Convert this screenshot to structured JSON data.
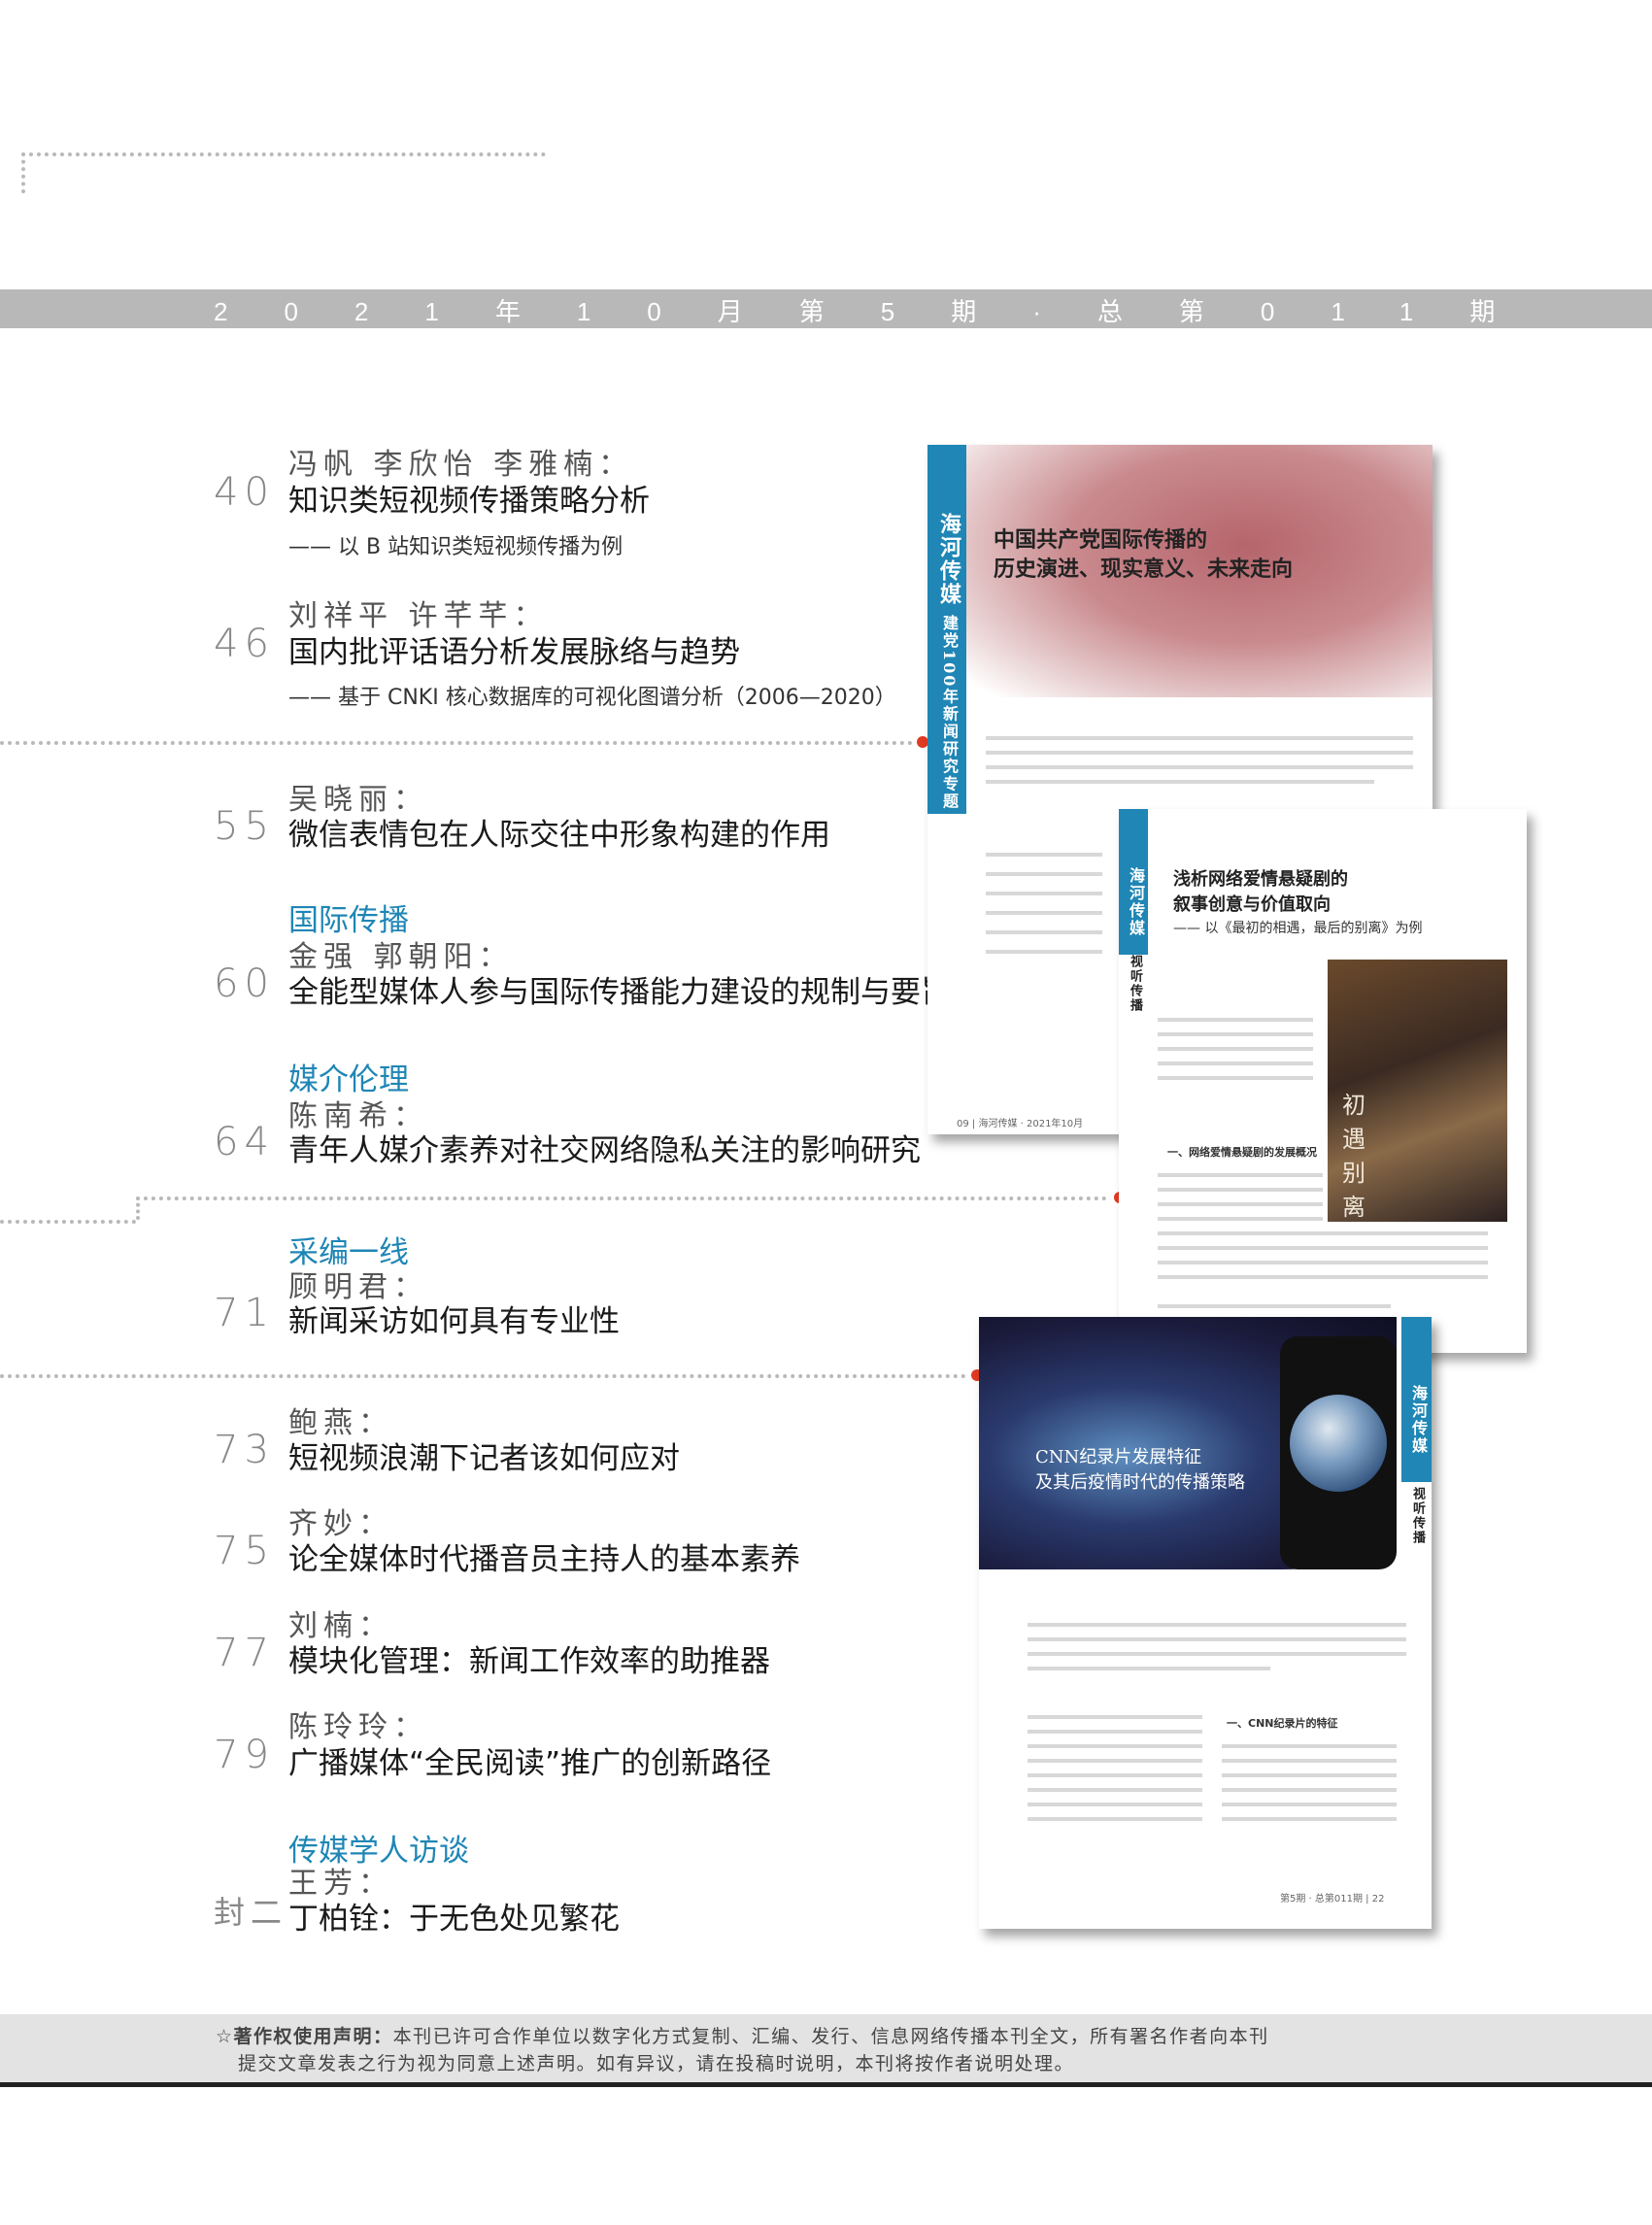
{
  "issue_line": "2021年10月第5期·总第011期",
  "articles": [
    {
      "authors": "冯帆 李欣怡 李雅楠：",
      "page": "40",
      "title": "知识类短视频传播策略分析",
      "subtitle": "—— 以 B 站知识类短视频传播为例"
    },
    {
      "authors": "刘祥平 许芊芊：",
      "page": "46",
      "title": "国内批评话语分析发展脉络与趋势",
      "subtitle": "—— 基于 CNKI 核心数据库的可视化图谱分析（2006—2020）"
    },
    {
      "authors": "吴晓丽：",
      "page": "55",
      "title": "微信表情包在人际交往中形象构建的作用"
    },
    {
      "section": "国际传播",
      "authors": "金强 郭朝阳：",
      "page": "60",
      "title": "全能型媒体人参与国际传播能力建设的规制与要旨"
    },
    {
      "section": "媒介伦理",
      "authors": "陈南希：",
      "page": "64",
      "title": "青年人媒介素养对社交网络隐私关注的影响研究"
    },
    {
      "section": "采编一线",
      "authors": "顾明君：",
      "page": "71",
      "title": "新闻采访如何具有专业性"
    },
    {
      "authors": "鲍燕：",
      "page": "73",
      "title": "短视频浪潮下记者该如何应对"
    },
    {
      "authors": "齐妙：",
      "page": "75",
      "title": "论全媒体时代播音员主持人的基本素养"
    },
    {
      "authors": "刘楠：",
      "page": "77",
      "title": "模块化管理：新闻工作效率的助推器"
    },
    {
      "authors": "陈玲玲：",
      "page": "79",
      "title": "广播媒体“全民阅读”推广的创新路径"
    },
    {
      "section": "传媒学人访谈",
      "authors": "王芳：",
      "page": "封二",
      "title": "丁柏铨：于无色处见繁花"
    }
  ],
  "thumbnails": {
    "one": {
      "side": "海河传媒",
      "side2": "建党100年新闻研究专题",
      "title1": "中国共产党国际传播的",
      "title2": "历史演进、现实意义、未来走向",
      "footer": "09 | 海河传媒 · 2021年10月"
    },
    "two": {
      "side": "海河传媒",
      "side2": "视听传播",
      "title1": "浅析网络爱情悬疑剧的",
      "title2": "叙事创意与价值取向",
      "subtitle": "—— 以《最初的相遇，最后的别离》为例",
      "section_head": "一、网络爱情悬疑剧的发展概况",
      "poster_text": "初遇别离"
    },
    "three": {
      "side": "海河传媒",
      "side2": "视听传播",
      "title1": "CNN纪录片发展特征",
      "title2": "及其后疫情时代的传播策略",
      "section_head": "一、CNN纪录片的特征",
      "footer": "第5期 · 总第011期 | 22"
    }
  },
  "copyright": {
    "label": "著作权使用声明：",
    "line1": "本刊已许可合作单位以数字化方式复制、汇编、发行、信息网络传播本刊全文，所有署名作者向本刊",
    "line2": "提交文章发表之行为视为同意上述声明。如有异议，请在投稿时说明，本刊将按作者说明处理。",
    "star": "☆"
  },
  "colors": {
    "accent": "#1f86b5",
    "dot": "#e03a23",
    "bar": "#b8b8b8"
  }
}
